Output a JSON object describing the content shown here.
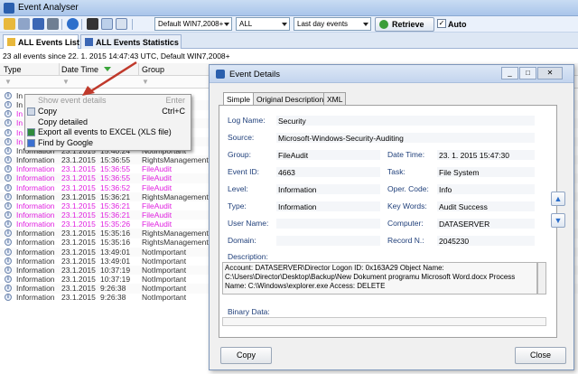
{
  "window": {
    "title": "Event Analyser"
  },
  "toolbar": {
    "icons": [
      "open-folder-icon",
      "open-db-icon",
      "save-icon",
      "print-icon",
      "help-icon",
      "find-icon",
      "filter-icon",
      "list-view-icon"
    ],
    "dropdown_source": "Default WIN7,2008+",
    "dropdown_log": "ALL",
    "dropdown_range": "Last day events",
    "retrieve_label": "Retrieve",
    "auto_label": "Auto",
    "auto_checked": "✓"
  },
  "tabs": [
    {
      "label": "ALL Events List",
      "active": true
    },
    {
      "label": "ALL Events Statistics",
      "active": false
    }
  ],
  "status": "23 all events since 22. 1. 2015  14:47:43 UTC, Default WIN7,2008+",
  "columns": {
    "type": "Type",
    "datetime": "Date Time",
    "group": "Group"
  },
  "colors": {
    "magenta_row": "#e020e0",
    "accent": "#2a5fae",
    "label_blue": "#1f3f7a",
    "arrow": "#c0392b"
  },
  "rows": [
    {
      "type": "In",
      "date": "",
      "time": "",
      "group": "",
      "magenta": false
    },
    {
      "type": "In",
      "date": "",
      "time": "",
      "group": "ent",
      "magenta": false
    },
    {
      "type": "In",
      "date": "",
      "time": "",
      "group": "",
      "magenta": true
    },
    {
      "type": "In",
      "date": "",
      "time": "",
      "group": "",
      "magenta": true
    },
    {
      "type": "In",
      "date": "",
      "time": "",
      "group": "",
      "magenta": true
    },
    {
      "type": "In",
      "date": "",
      "time": "",
      "group": "",
      "magenta": true
    },
    {
      "type": "Information",
      "date": "23.1.2015",
      "time": "15:40:24",
      "group": "NotImportant",
      "magenta": false
    },
    {
      "type": "Information",
      "date": "23.1.2015",
      "time": "15:36:55",
      "group": "RightsManagement",
      "magenta": false
    },
    {
      "type": "Information",
      "date": "23.1.2015",
      "time": "15:36:55",
      "group": "FileAudit",
      "magenta": true
    },
    {
      "type": "Information",
      "date": "23.1.2015",
      "time": "15:36:55",
      "group": "FileAudit",
      "magenta": true
    },
    {
      "type": "Information",
      "date": "23.1.2015",
      "time": "15:36:52",
      "group": "FileAudit",
      "magenta": true
    },
    {
      "type": "Information",
      "date": "23.1.2015",
      "time": "15:36:21",
      "group": "RightsManagement",
      "magenta": false
    },
    {
      "type": "Information",
      "date": "23.1.2015",
      "time": "15:36:21",
      "group": "FileAudit",
      "magenta": true
    },
    {
      "type": "Information",
      "date": "23.1.2015",
      "time": "15:36:21",
      "group": "FileAudit",
      "magenta": true
    },
    {
      "type": "Information",
      "date": "23.1.2015",
      "time": "15:35:26",
      "group": "FileAudit",
      "magenta": true
    },
    {
      "type": "Information",
      "date": "23.1.2015",
      "time": "15:35:16",
      "group": "RightsManagement",
      "magenta": false
    },
    {
      "type": "Information",
      "date": "23.1.2015",
      "time": "15:35:16",
      "group": "RightsManagement",
      "magenta": false
    },
    {
      "type": "Information",
      "date": "23.1.2015",
      "time": "13:49:01",
      "group": "NotImportant",
      "magenta": false
    },
    {
      "type": "Information",
      "date": "23.1.2015",
      "time": "13:49:01",
      "group": "NotImportant",
      "magenta": false
    },
    {
      "type": "Information",
      "date": "23.1.2015",
      "time": "10:37:19",
      "group": "NotImportant",
      "magenta": false
    },
    {
      "type": "Information",
      "date": "23.1.2015",
      "time": "10:37:19",
      "group": "NotImportant",
      "magenta": false
    },
    {
      "type": "Information",
      "date": "23.1.2015",
      "time": "9:26:38",
      "group": "NotImportant",
      "magenta": false
    },
    {
      "type": "Information",
      "date": "23.1.2015",
      "time": "9:26:38",
      "group": "NotImportant",
      "magenta": false
    }
  ],
  "context_menu": {
    "items": [
      {
        "label": "Show event details",
        "shortcut": "Enter",
        "disabled": true,
        "icon": ""
      },
      {
        "label": "Copy",
        "shortcut": "Ctrl+C",
        "disabled": false,
        "icon": "copy-icon"
      },
      {
        "label": "Copy detailed",
        "shortcut": "",
        "disabled": false,
        "icon": ""
      },
      {
        "label": "Export all events to EXCEL (XLS file)",
        "shortcut": "",
        "disabled": false,
        "icon": "excel-icon"
      },
      {
        "label": "Find by Google",
        "shortcut": "",
        "disabled": false,
        "icon": "google-icon"
      }
    ]
  },
  "dialog": {
    "title": "Event Details",
    "tabs": [
      "Simple",
      "Original Description",
      "XML"
    ],
    "fields": {
      "log_name_label": "Log Name:",
      "log_name": "Security",
      "source_label": "Source:",
      "source": "Microsoft-Windows-Security-Auditing",
      "group_label": "Group:",
      "group": "FileAudit",
      "datetime_label": "Date Time:",
      "datetime": "23. 1. 2015 15:47:30",
      "eventid_label": "Event ID:",
      "eventid": "4663",
      "task_label": "Task:",
      "task": "File System",
      "level_label": "Level:",
      "level": "Information",
      "opcode_label": "Oper. Code:",
      "opcode": "Info",
      "type_label": "Type:",
      "type": "Information",
      "keywords_label": "Key Words:",
      "keywords": "Audit Success",
      "username_label": "User Name:",
      "username": "",
      "computer_label": "Computer:",
      "computer": "DATASERVER",
      "domain_label": "Domain:",
      "domain": "",
      "recordn_label": "Record N.:",
      "recordn": "2045230"
    },
    "description_label": "Description:",
    "description": "Account: DATASERVER\\Director Logon ID: 0x163A29 Object Name: C:\\Users\\Director\\Desktop\\Backup\\New Dokument programu Microsoft Word.docx Process Name: C:\\Windows\\explorer.exe Access: DELETE",
    "binary_label": "Binary Data:",
    "copy_label": "Copy",
    "close_label": "Close"
  }
}
